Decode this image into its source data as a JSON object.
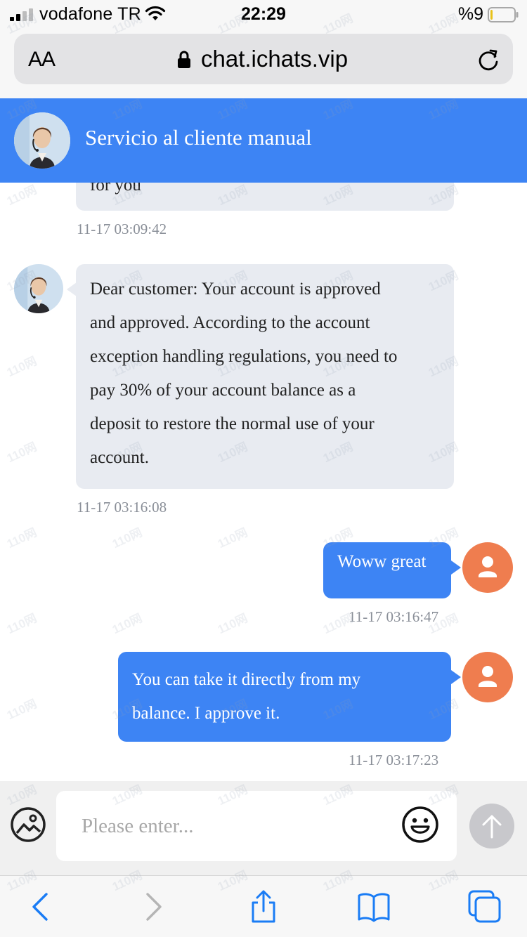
{
  "status_bar": {
    "carrier": "vodafone TR",
    "time": "22:29",
    "battery_percent": "%9",
    "battery_level": 0.09
  },
  "browser": {
    "text_size_label": "AA",
    "url": "chat.ichats.vip"
  },
  "chat_header": {
    "title": "Servicio al cliente manual"
  },
  "messages": [
    {
      "from": "agent",
      "text": "for you",
      "time": "11-17 03:09:42"
    },
    {
      "from": "agent",
      "lines": [
        "Dear customer: Your account is approved",
        "and approved. According to the account",
        "exception handling regulations, you need to",
        "pay 30% of your account balance as a",
        "deposit to restore the normal use of your",
        "account."
      ],
      "time": "11-17 03:16:08"
    },
    {
      "from": "user",
      "text": "Woww great",
      "time": "11-17 03:16:47"
    },
    {
      "from": "user",
      "lines": [
        "You can take it directly from my",
        "balance. I approve it."
      ],
      "time": "11-17 03:17:23"
    }
  ],
  "input": {
    "placeholder": "Please enter..."
  },
  "watermark": "110网",
  "colors": {
    "header_blue": "#3d84f4",
    "agent_bubble": "#e8ebf1",
    "user_avatar": "#ef7d4f",
    "timestamp": "#8a8f98"
  }
}
